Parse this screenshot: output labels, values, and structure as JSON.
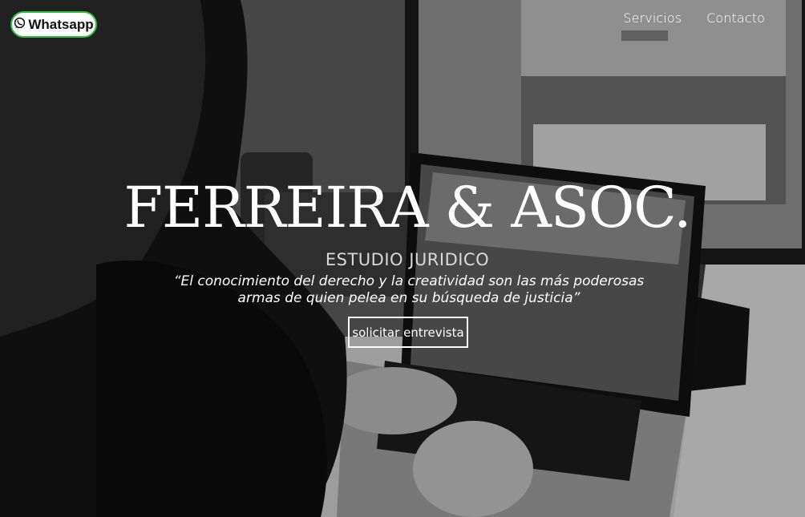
{
  "header": {
    "whatsapp_label": "Whatsapp",
    "nav": [
      {
        "label": "Servicios"
      },
      {
        "label": "Contacto"
      }
    ]
  },
  "hero": {
    "brand": "FERREIRA & ASOC.",
    "subtitle": "ESTUDIO JURIDICO",
    "quote_line1": "“El conocimiento del derecho y la creatividad son las más poderosas",
    "quote_line2": "armas de quien pelea en su búsqueda de justicia”",
    "cta_label": "solicitar entrevista"
  },
  "icons": {
    "whatsapp": "whatsapp-icon"
  },
  "colors": {
    "whatsapp_border": "#2fbf41",
    "text": "#ffffff"
  }
}
